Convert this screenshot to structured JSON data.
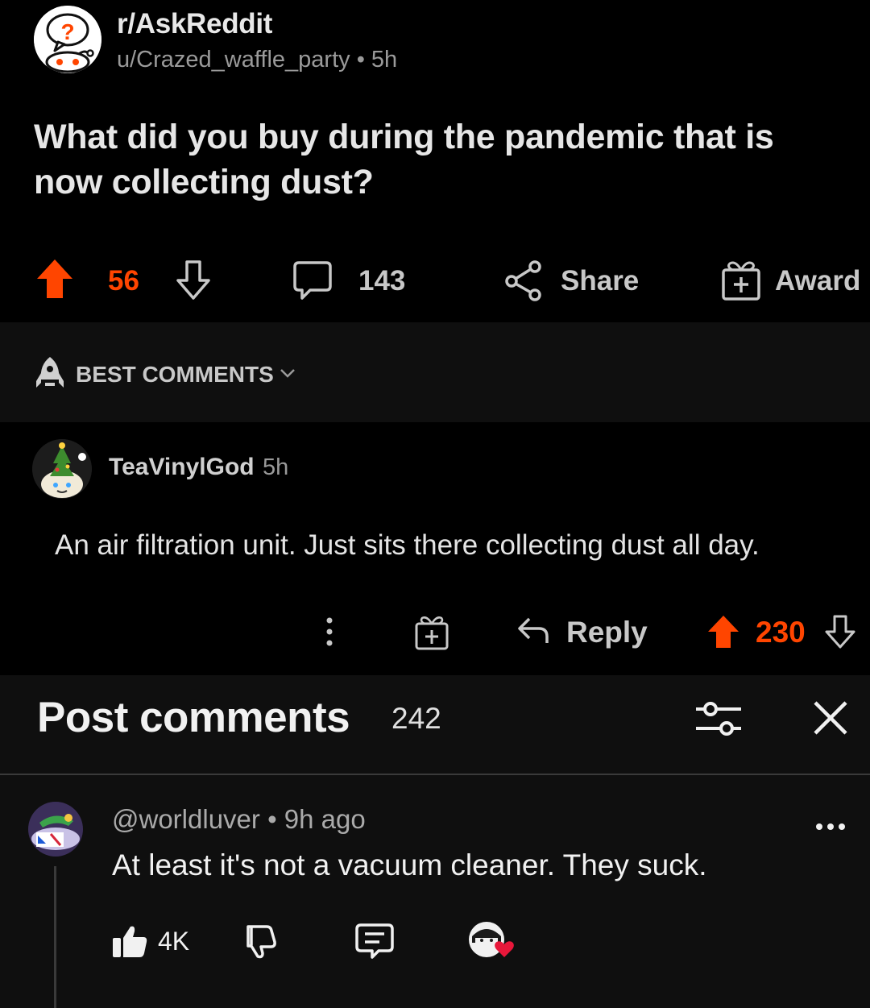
{
  "post": {
    "subreddit": "r/AskReddit",
    "author": "u/Crazed_waffle_party",
    "separator": "•",
    "age": "5h",
    "title": "What did you buy during the pandemic that is now collecting dust?",
    "upvotes": "56",
    "comments": "143",
    "share_label": "Share",
    "award_label": "Award"
  },
  "sort": {
    "label": "BEST COMMENTS"
  },
  "reddit_comment": {
    "author": "TeaVinylGod",
    "age": "5h",
    "body": "An air filtration unit. Just sits there collecting dust all day.",
    "reply_label": "Reply",
    "votes": "230"
  },
  "yt_panel": {
    "title": "Post comments",
    "count": "242",
    "comment": {
      "author": "@worldluver",
      "separator": "•",
      "age": "9h ago",
      "body": "At least it's not a vacuum cleaner. They suck.",
      "likes": "4K"
    }
  },
  "colors": {
    "upvote_orange": "#ff4500",
    "background": "#000000",
    "panel_bg": "#0f0f0f",
    "heart_red": "#e8173a"
  }
}
